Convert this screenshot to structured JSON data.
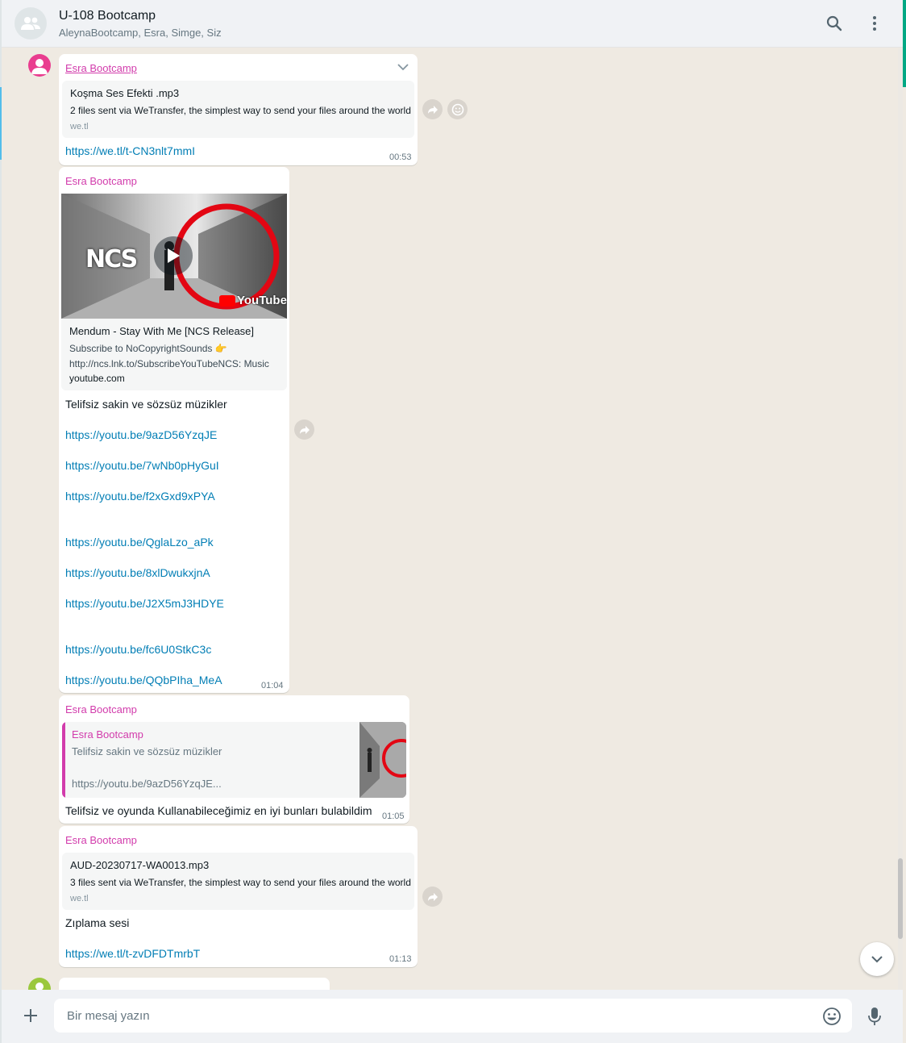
{
  "header": {
    "title": "U-108 Bootcamp",
    "participants": "AleynaBootcamp, Esra, Simge, Siz"
  },
  "messages": [
    {
      "sender": "Esra Bootcamp",
      "preview_title": "Koşma Ses Efekti .mp3",
      "preview_desc": "2 files sent via WeTransfer, the simplest way to send your files around the world",
      "preview_domain": "we.tl",
      "link": "https://we.tl/t-CN3nlt7mmI",
      "time": "00:53"
    },
    {
      "sender": "Esra Bootcamp",
      "thumbnail_badge": "YouTube",
      "thumbnail_logo": "NCS",
      "preview_title": "Mendum - Stay With Me [NCS Release]",
      "preview_desc": "Subscribe to NoCopyrightSounds 👉",
      "preview_desc2": "http://ncs.lnk.to/SubscribeYouTubeNCS: Music",
      "preview_domain": "youtube.com",
      "text": "Telifsiz sakin ve sözsüz müzikler",
      "links": [
        "https://youtu.be/9azD56YzqJE",
        "https://youtu.be/7wNb0pHyGuI",
        "https://youtu.be/f2xGxd9xPYA",
        "https://youtu.be/QglaLzo_aPk",
        "https://youtu.be/8xlDwukxjnA",
        "https://youtu.be/J2X5mJ3HDYE",
        "https://youtu.be/fc6U0StkC3c",
        "https://youtu.be/QQbPIha_MeA"
      ],
      "time": "01:04"
    },
    {
      "sender": "Esra Bootcamp",
      "quote_sender": "Esra Bootcamp",
      "quote_line1": "Telifsiz sakin ve sözsüz müzikler",
      "quote_line2": "https://youtu.be/9azD56YzqJE...",
      "text": "Telifsiz ve oyunda Kullanabileceğimiz en iyi bunları bulabildim",
      "time": "01:05"
    },
    {
      "sender": "Esra Bootcamp",
      "preview_title": "AUD-20230717-WA0013.mp3",
      "preview_desc": "3 files sent via WeTransfer, the simplest way to send your files around the world",
      "preview_domain": "we.tl",
      "text": "Zıplama sesi",
      "link": "https://we.tl/t-zvDFDTmrbT",
      "time": "01:13"
    }
  ],
  "composer": {
    "placeholder": "Bir mesaj yazın"
  },
  "colors": {
    "sender": "#d23cac",
    "link": "#027eb5",
    "chat_bg": "#efeae2",
    "header_bg": "#f0f2f5",
    "accent": "#00a884"
  },
  "icons": [
    "group-avatar-icon",
    "search-icon",
    "menu-icon",
    "forward-icon",
    "emoji-reaction-icon",
    "play-icon",
    "chevron-down-icon",
    "plus-icon",
    "emoji-icon",
    "microphone-icon"
  ]
}
